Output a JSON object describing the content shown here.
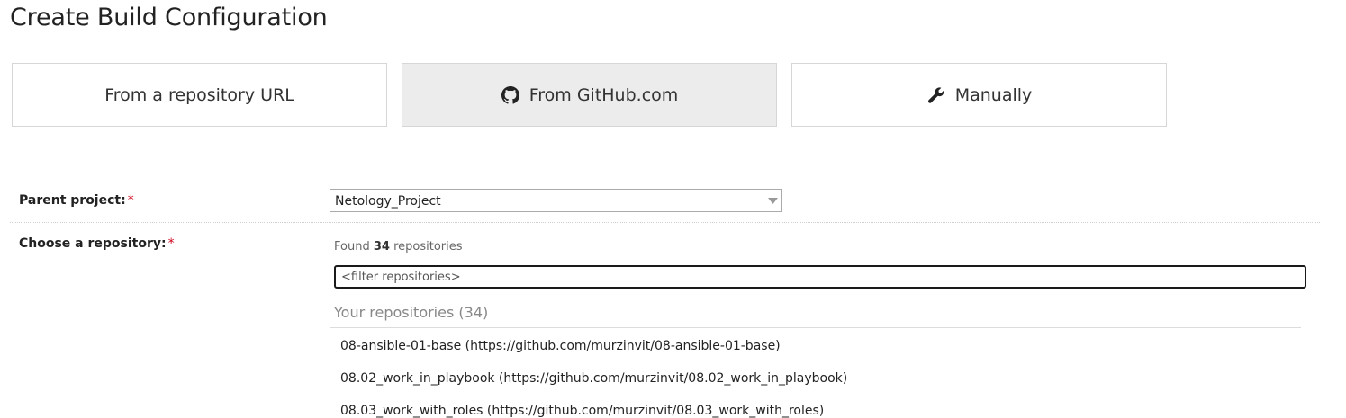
{
  "page": {
    "title": "Create Build Configuration"
  },
  "options": [
    {
      "label": "From a repository URL",
      "icon": "",
      "selected": false
    },
    {
      "label": "From GitHub.com",
      "icon": "github-icon",
      "selected": true
    },
    {
      "label": "Manually",
      "icon": "wrench-icon",
      "selected": false
    }
  ],
  "form": {
    "parent_project": {
      "label": "Parent project:",
      "required_mark": "*",
      "value": "Netology_Project"
    },
    "repository": {
      "label": "Choose a repository:",
      "required_mark": "*",
      "found_prefix": "Found",
      "found_count": "34",
      "found_suffix": "repositories",
      "filter_placeholder": "<filter repositories>",
      "group_header": "Your repositories (34)",
      "items": [
        "08-ansible-01-base (https://github.com/murzinvit/08-ansible-01-base)",
        "08.02_work_in_playbook (https://github.com/murzinvit/08.02_work_in_playbook)",
        "08.03_work_with_roles (https://github.com/murzinvit/08.03_work_with_roles)"
      ]
    }
  },
  "colors": {
    "selected_card_bg": "#ececec",
    "required": "#d0021b",
    "border": "#d6d6d6"
  }
}
